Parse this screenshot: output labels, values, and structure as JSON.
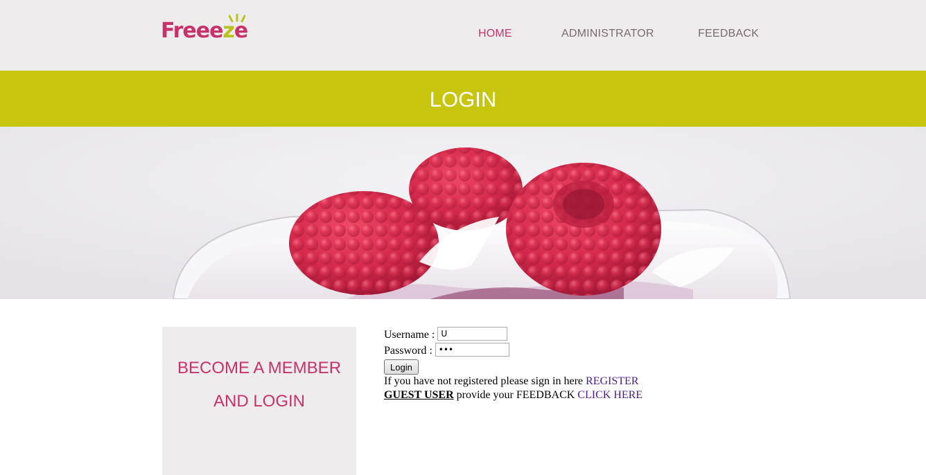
{
  "header": {
    "logo": {
      "part1": "Freee",
      "part2": "z",
      "part3": "e"
    },
    "nav": [
      {
        "label": "HOME",
        "active": true
      },
      {
        "label": "ADMINISTRATOR",
        "active": false
      },
      {
        "label": "FEEDBACK",
        "active": false
      }
    ]
  },
  "banner": {
    "title": "LOGIN"
  },
  "hero": {
    "image": "raspberries-on-yogurt"
  },
  "side_box": {
    "text": "BECOME A MEMBER AND LOGIN"
  },
  "login_form": {
    "username_label": "Username :",
    "username_value": "U",
    "password_label": "Password :",
    "password_value": "•••",
    "login_button": "Login",
    "register_text": "If you have not registered please sign in here",
    "register_link": "REGISTER",
    "guest_label": "GUEST USER",
    "feedback_text": "provide your FEEDBACK",
    "feedback_link": "CLICK HERE"
  },
  "colors": {
    "brand_pink": "#c8326a",
    "banner_lime": "#c8c50f",
    "header_bg": "#eeeced",
    "link_purple": "#4c1b8c"
  }
}
